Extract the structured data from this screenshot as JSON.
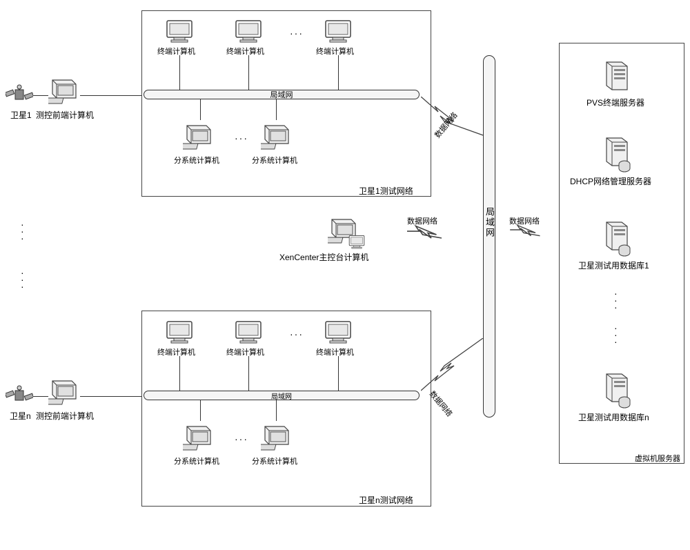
{
  "sat_ids": [
    "1",
    "n"
  ],
  "labels": {
    "satellite_prefix": "卫星",
    "test_net_suffix": "测试网络",
    "tc_computer": "测控前端计算机",
    "terminal_computer": "终端计算机",
    "subsystem_computer": "分系统计算机",
    "lan": "局域网",
    "xen_center": "XenCenter主控台计算机",
    "data_network": "数据网络",
    "vm_server": "虚拟机服务器",
    "pvs_server": "PVS终端服务器",
    "dhcp_server": "DHCP网络管理服务器",
    "db_prefix": "卫星测试用数据库"
  }
}
